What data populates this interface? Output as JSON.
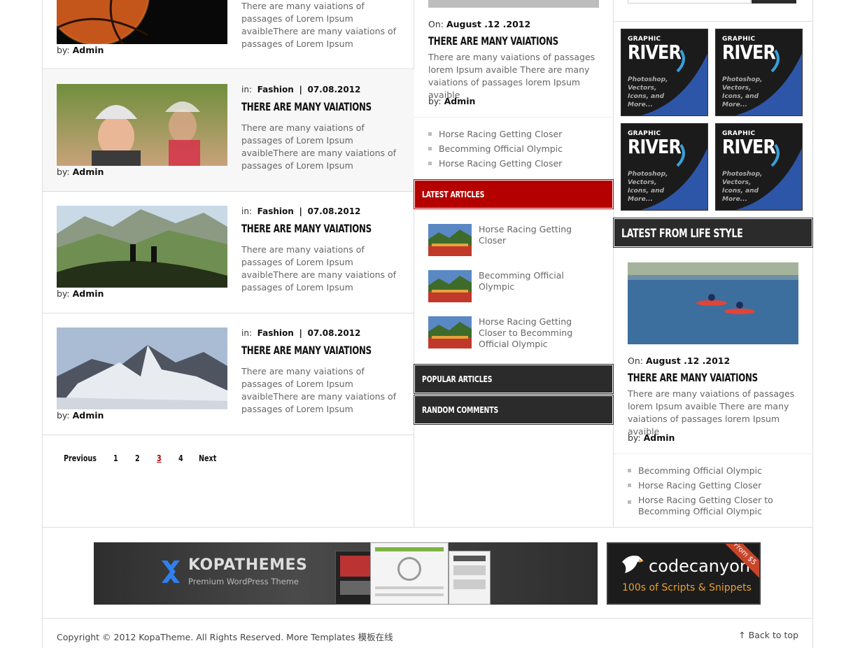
{
  "main_articles": [
    {
      "excerpt": "There are many vaiations of passages of Lorem Ipsum avaibleThere are many vaiations of passages of Lorem Ipsum",
      "by_label": "by:",
      "author": "Admin"
    },
    {
      "in_label": "in:",
      "category": "Fashion",
      "sep": "|",
      "date": "07.08.2012",
      "title": "There are many vaiations",
      "excerpt": "There are many vaiations of passages of Lorem Ipsum avaibleThere are many vaiations of passages of Lorem Ipsum",
      "by_label": "by:",
      "author": "Admin"
    },
    {
      "in_label": "in:",
      "category": "Fashion",
      "sep": "|",
      "date": "07.08.2012",
      "title": "There are many vaiations",
      "excerpt": "There are many vaiations of passages of Lorem Ipsum avaibleThere are many vaiations of passages of Lorem Ipsum",
      "by_label": "by:",
      "author": "Admin"
    },
    {
      "in_label": "in:",
      "category": "Fashion",
      "sep": "|",
      "date": "07.08.2012",
      "title": "There are many vaiations",
      "excerpt": "There are many vaiations of passages of Lorem Ipsum avaibleThere are many vaiations of passages of Lorem Ipsum",
      "by_label": "by:",
      "author": "Admin"
    }
  ],
  "pagination": {
    "previous": "Previous",
    "pages": [
      "1",
      "2",
      "3",
      "4"
    ],
    "current": "3",
    "next": "Next"
  },
  "middle": {
    "featured": {
      "on_label": "On:",
      "date": "August .12 .2012",
      "title": "There are many vaiations",
      "excerpt": "There are many vaiations of passages lorem Ipsum avaible There are many vaiations of passages lorem Ipsum avaible",
      "by_label": "by:",
      "author": "Admin"
    },
    "links": [
      "Horse Racing Getting Closer",
      "Becomming Official Olympic",
      "Horse Racing Getting Closer"
    ],
    "latest_articles_title": "Latest Articles",
    "latest_articles": [
      "Horse Racing Getting Closer",
      "Becomming Official Olympic",
      "Horse Racing Getting Closer to Becomming Official Olympic"
    ],
    "popular_title": "Popular Articles",
    "random_title": "Random Comments"
  },
  "right": {
    "ads": [
      {
        "small": "GRAPHIC",
        "big": "RIVER",
        "desc": "Photoshop, Vectors, Icons, and More..."
      },
      {
        "small": "GRAPHIC",
        "big": "RIVER",
        "desc": "Photoshop, Vectors, Icons, and More..."
      },
      {
        "small": "GRAPHIC",
        "big": "RIVER",
        "desc": "Photoshop, Vectors, Icons, and More..."
      },
      {
        "small": "GRAPHIC",
        "big": "RIVER",
        "desc": "Photoshop, Vectors, Icons, and More..."
      }
    ],
    "lifestyle_title": "Latest from Life Style",
    "featured": {
      "on_label": "On:",
      "date": "August .12 .2012",
      "title": "There are many vaiations",
      "excerpt": "There are many vaiations of passages lorem Ipsum avaible There are many vaiations of passages lorem Ipsum avaible",
      "by_label": "by:",
      "author": "Admin"
    },
    "links": [
      "Becomming Official Olympic",
      "Horse Racing Getting Closer",
      "Horse Racing Getting Closer to Becomming Official Olympic"
    ]
  },
  "banners": {
    "kopa_brand": "KOPATHEMES",
    "kopa_tag": "Premium WordPress Theme",
    "codecanyon_brand": "codecanyon",
    "codecanyon_tag": "100s of Scripts & Snippets",
    "codecanyon_ribbon": "From $5"
  },
  "footer": {
    "copyright": "Copyright © 2012 KopaTheme. All Rights Reserved. More Templates 模板在线",
    "back_to_top": "Back to top"
  },
  "colors": {
    "accent_red": "#b50000",
    "dark_bar": "#2b2b2b",
    "river_blue": "#2d56a8"
  }
}
